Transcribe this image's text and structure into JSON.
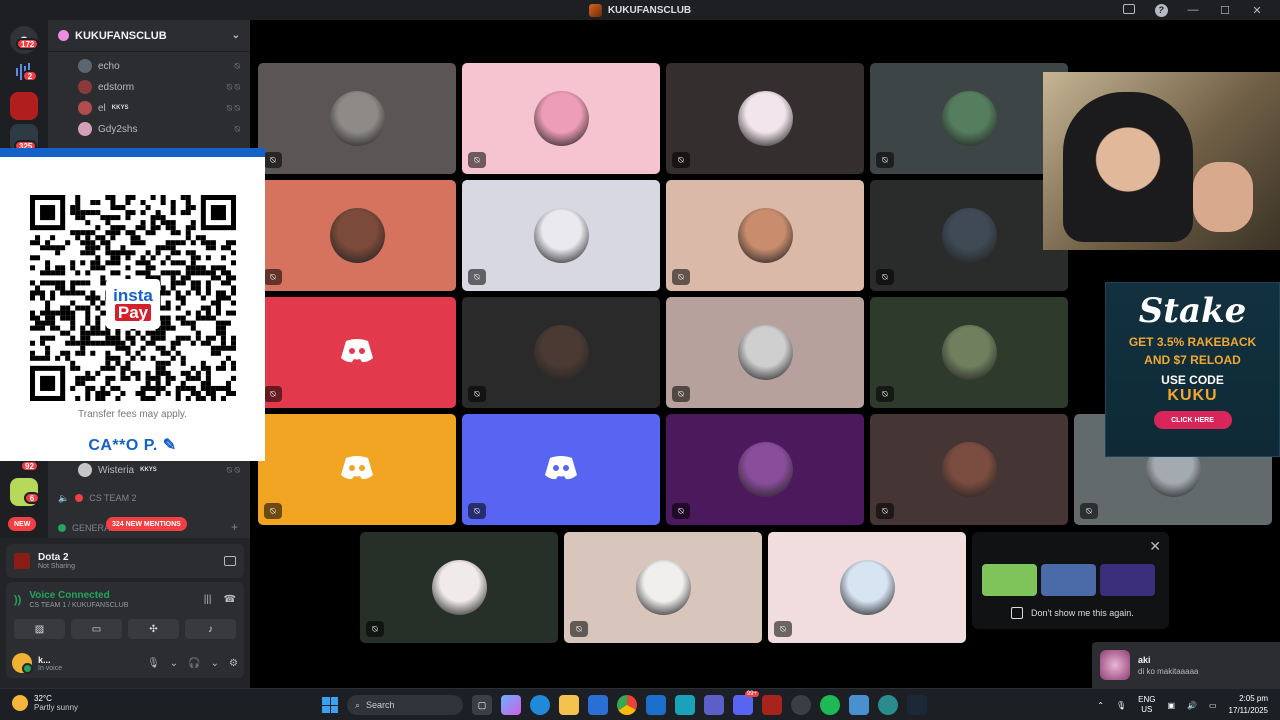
{
  "window": {
    "title": "KUKUFANSCLUB"
  },
  "rail": {
    "badges": [
      "172",
      "2",
      "325",
      "92",
      "6"
    ]
  },
  "channels": {
    "server_name": "KUKUFANSCLUB",
    "members": [
      {
        "name": "echo",
        "color": "#5b6770"
      },
      {
        "name": "edstorm",
        "color": "#8a3a3a"
      },
      {
        "name": "el",
        "color": "#b24d4d",
        "tag": "KKYS"
      },
      {
        "name": "Gdy2shs",
        "color": "#d2a0b8"
      }
    ],
    "wisteria": {
      "name": "Wisteria",
      "tag": "KKYS"
    },
    "cs_team_2": "CS TEAM 2",
    "general": "GENERA",
    "new_label": "NEW",
    "mentions_label": "324 NEW MENTIONS"
  },
  "voice_panel": {
    "game": {
      "name": "Dota 2",
      "status": "Not Sharing"
    },
    "connection": {
      "status": "Voice Connected",
      "location": "CS TEAM 1 / KUKUFANSCLUB"
    },
    "user": {
      "name": "k...",
      "status": "In voice"
    }
  },
  "qr_overlay": {
    "logo_top": "insta",
    "logo_bottom": "Pay",
    "note": "Transfer fees may apply.",
    "account_name": "CA**O P."
  },
  "tiles": [
    {
      "bg": "#5b5655",
      "av": "#8d8a88"
    },
    {
      "bg": "#f6c3d1",
      "av": "#ee9db8"
    },
    {
      "bg": "#352e2e",
      "av": "#f2e6ec"
    },
    {
      "bg": "#3e4546",
      "av": "#557e5f"
    },
    {
      "bg": "#d5735e",
      "av": "#7b4a3a"
    },
    {
      "bg": "#d7d8e1",
      "av": "#e9e9ee"
    },
    {
      "bg": "#dbb9a9",
      "av": "#c98d6e"
    },
    {
      "bg": "#2a2b2b",
      "av": "#3f4a55"
    },
    {
      "bg": "#e23a4c",
      "av": null
    },
    {
      "bg": "#2a2a2b",
      "av": "#4a3a33"
    },
    {
      "bg": "#b7a19c",
      "av": "#cfcfcf"
    },
    {
      "bg": "#2d3a2c",
      "av": "#70805e"
    },
    {
      "bg": "#f2a423",
      "av": null
    },
    {
      "bg": "#5865f2",
      "av": null
    },
    {
      "bg": "#4c1a5c",
      "av": "#8a4d9c"
    },
    {
      "bg": "#463535",
      "av": "#7a4d40"
    },
    {
      "bg": "#636a6c",
      "av": "#a3aab0"
    },
    {
      "bg": "#263029",
      "av": "#f0eaea"
    },
    {
      "bg": "#d8c6bd",
      "av": "#f0efee"
    },
    {
      "bg": "#f1dddd",
      "av": "#d7e4f2"
    }
  ],
  "stake_ad": {
    "brand": "Stake",
    "line1": "GET 3.5% RAKEBACK",
    "line2": "AND $7 RELOAD",
    "line3": "USE CODE",
    "code": "KUKU",
    "cta": "CLICK HERE"
  },
  "activity_popup": {
    "dont_show": "Don't show me this again.",
    "thumbs": [
      "#7fc45a",
      "#4a6aa8",
      "#3b2f7c"
    ]
  },
  "toast": {
    "name": "aki",
    "message": "di ko makitaaaaa"
  },
  "taskbar": {
    "temperature": "32°C",
    "condition": "Partly sunny",
    "search_placeholder": "Search",
    "lang1": "ENG",
    "lang2": "US",
    "time": "2:05 pm",
    "date": "17/11/2025",
    "discord_badge": "99+"
  }
}
